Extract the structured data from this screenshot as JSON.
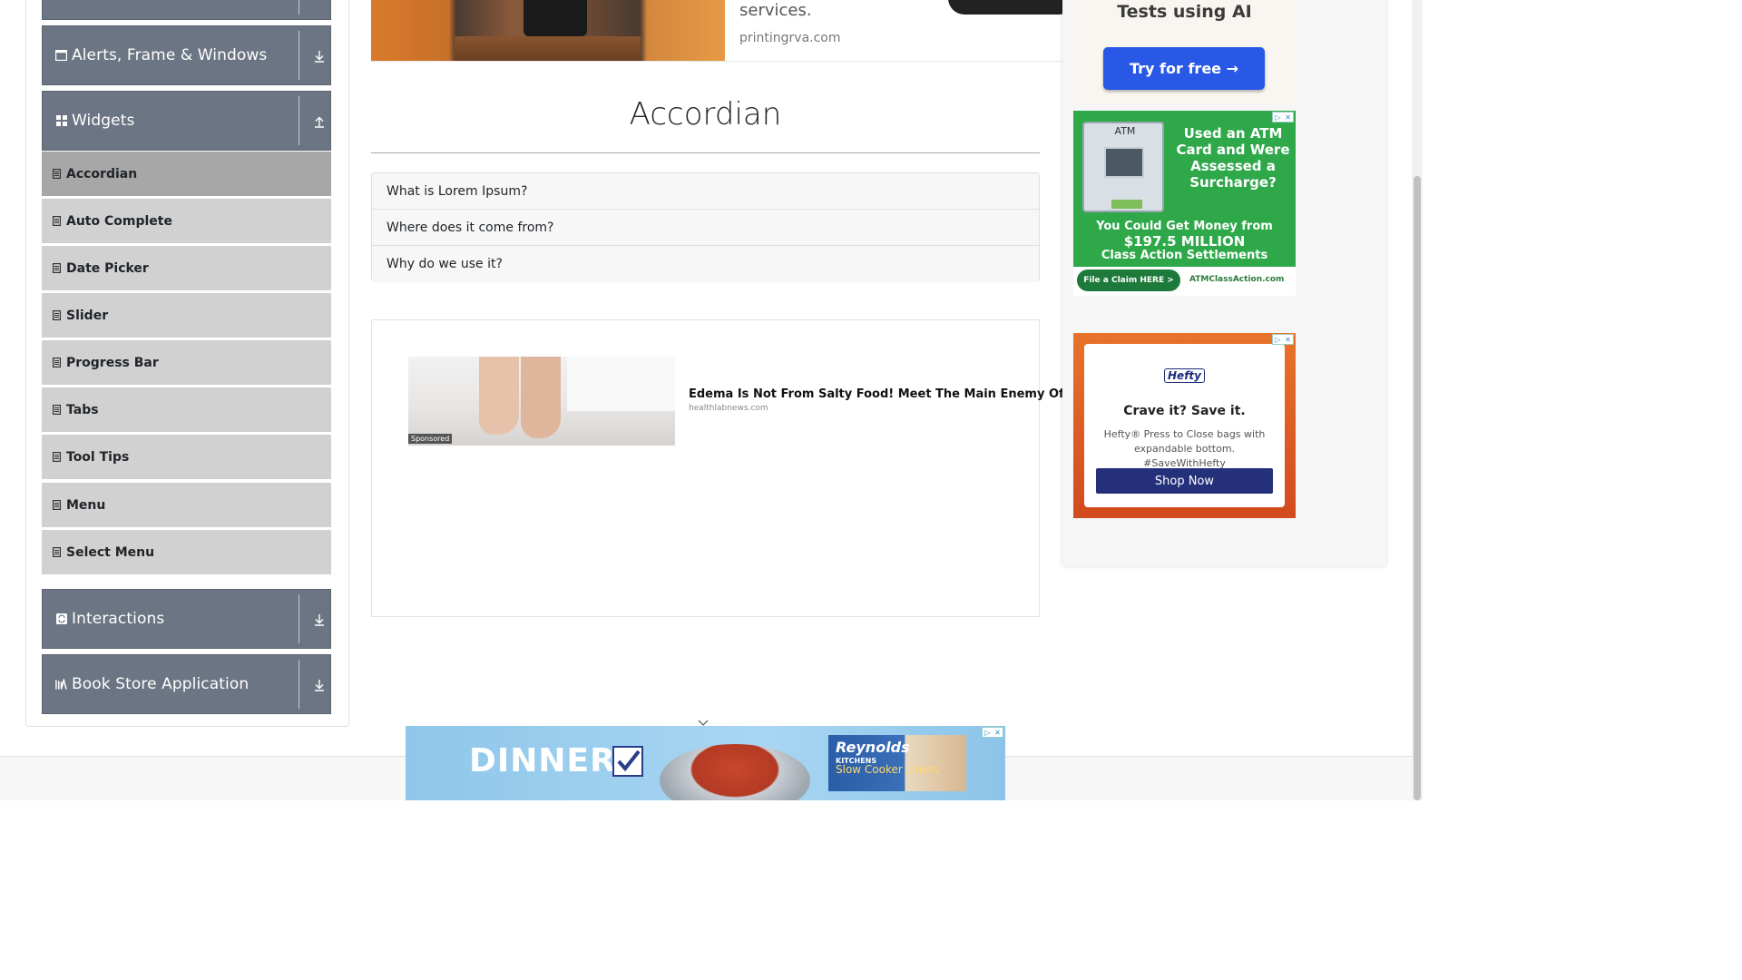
{
  "sidebar": {
    "groups": [
      {
        "label": "Alerts, Frame & Windows",
        "icon": "window-icon",
        "expanded": false
      },
      {
        "label": "Widgets",
        "icon": "grid-icon",
        "expanded": true
      },
      {
        "label": "Interactions",
        "icon": "interactions-icon",
        "expanded": false
      },
      {
        "label": "Book Store Application",
        "icon": "book-icon",
        "expanded": false
      }
    ],
    "widget_items": [
      {
        "label": "Accordian",
        "active": true
      },
      {
        "label": "Auto Complete",
        "active": false
      },
      {
        "label": "Date Picker",
        "active": false
      },
      {
        "label": "Slider",
        "active": false
      },
      {
        "label": "Progress Bar",
        "active": false
      },
      {
        "label": "Tabs",
        "active": false
      },
      {
        "label": "Tool Tips",
        "active": false
      },
      {
        "label": "Menu",
        "active": false
      },
      {
        "label": "Select Menu",
        "active": false
      }
    ]
  },
  "top_ad": {
    "text": "services.",
    "domain": "printingrva.com"
  },
  "main": {
    "title": "Accordian",
    "accordion_items": [
      {
        "label": "What is Lorem Ipsum?"
      },
      {
        "label": "Where does it come from?"
      },
      {
        "label": "Why do we use it?"
      }
    ]
  },
  "native_ad": {
    "headline": "Edema Is Not From Salty Food! Meet The Main Enemy Of Edema",
    "domain": "healthlabnews.com",
    "sponsored_label": "Sponsored"
  },
  "right_ads": {
    "ai_ad": {
      "title": "Tests using AI",
      "button": "Try for free →"
    },
    "atm_ad": {
      "machine_label": "ATM",
      "headline": "Used an ATM Card and Were Assessed a Surcharge?",
      "money_line1": "You Could Get Money from",
      "money_amount": "$197.5 MILLION",
      "money_line2": "Class Action Settlements",
      "claim_button": "File a Claim HERE >",
      "site": "ATMClassAction.com"
    },
    "hefty_ad": {
      "logo": "Hefty",
      "headline": "Crave it? Save it.",
      "body": "Hefty® Press to Close bags with expandable bottom. #SaveWithHefty",
      "button": "Shop Now"
    },
    "adchoices": {
      "left": "▷",
      "right": "✕"
    }
  },
  "bottom_ad": {
    "headline": "DINNER.",
    "brand": "Reynolds",
    "brand_sub": "KITCHENS",
    "product": "Slow Cooker Liners"
  },
  "colors": {
    "group_header_bg": "#6c7583",
    "menu_item_bg": "#d1d1d1",
    "menu_item_active_bg": "#a7a7a7",
    "ai_button": "#2a58e6",
    "atm_green": "#2fa84a",
    "hefty_blue": "#25307a"
  }
}
